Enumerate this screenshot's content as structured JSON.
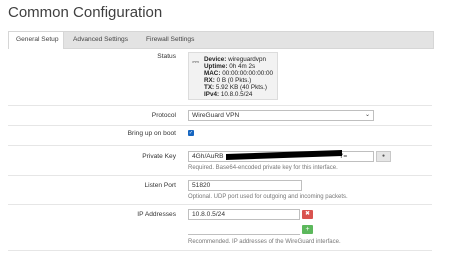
{
  "page": {
    "title": "Common Configuration"
  },
  "tabs": [
    {
      "label": "General Setup",
      "active": true
    },
    {
      "label": "Advanced Settings",
      "active": false
    },
    {
      "label": "Firewall Settings",
      "active": false
    }
  ],
  "status": {
    "label": "Status",
    "device_key": "Device:",
    "device_val": "wireguardvpn",
    "uptime_key": "Uptime:",
    "uptime_val": "0h 4m 2s",
    "mac_key": "MAC:",
    "mac_val": "00:00:00:00:00:00",
    "rx_key": "RX:",
    "rx_val": "0 B (0 Pkts.)",
    "tx_key": "TX:",
    "tx_val": "5.92 KB (40 Pkts.)",
    "ipv4_key": "IPv4:",
    "ipv4_val": "10.8.0.5/24"
  },
  "protocol": {
    "label": "Protocol",
    "value": "WireGuard VPN"
  },
  "boot": {
    "label": "Bring up on boot",
    "checked": true
  },
  "private_key": {
    "label": "Private Key",
    "value_prefix": "4Gh/AuRB",
    "value_suffix": "Y=",
    "help": "Required. Base64-encoded private key for this interface."
  },
  "listen_port": {
    "label": "Listen Port",
    "value": "51820",
    "help": "Optional. UDP port used for outgoing and incoming packets."
  },
  "ip_addresses": {
    "label": "IP Addresses",
    "values": [
      "10.8.0.5/24"
    ],
    "help": "Recommended. IP addresses of the WireGuard interface."
  },
  "icons": {
    "status": "network-icon",
    "delete": "x-icon",
    "add": "plus-icon",
    "reveal": "eye-icon"
  },
  "colors": {
    "delete": "#d9534f",
    "add": "#5cb85c",
    "checkbox": "#1565c0"
  }
}
